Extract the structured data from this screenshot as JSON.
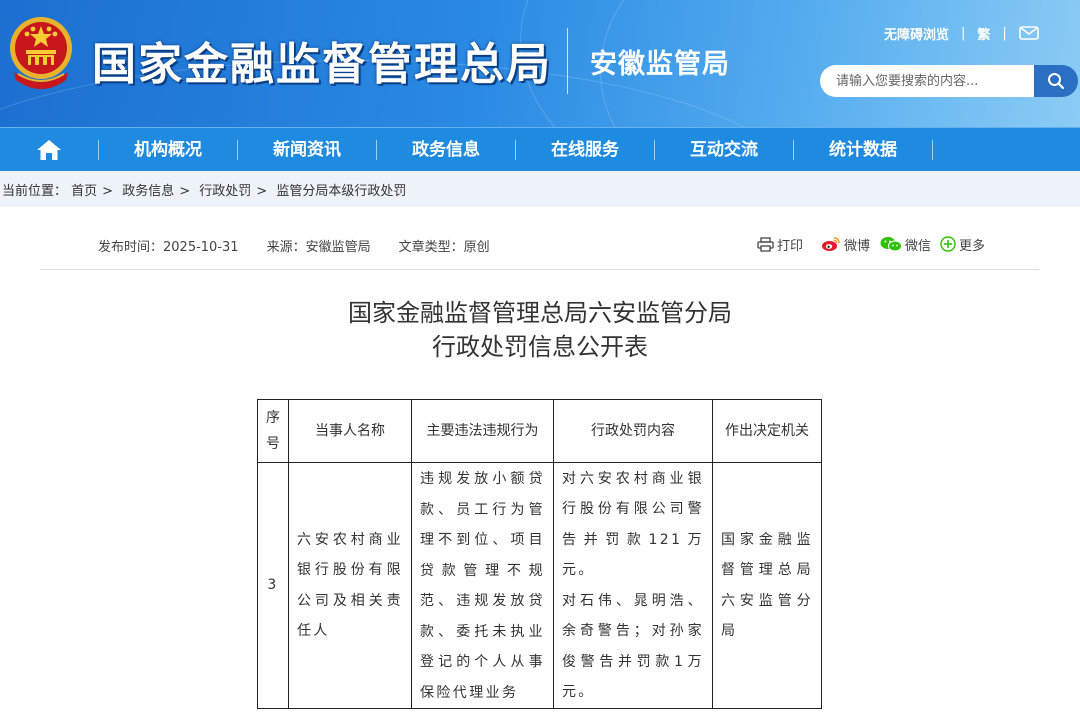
{
  "header": {
    "main_title": "国家金融监督管理总局",
    "sub_title": "安徽监管局",
    "links": {
      "accessibility": "无障碍浏览",
      "traditional": "繁"
    },
    "search": {
      "placeholder": "请输入您要搜索的内容..."
    },
    "colors": {
      "banner_start": "#1c6fd0",
      "banner_end": "#8cccf5",
      "nav": "#1e8ae0"
    }
  },
  "nav": {
    "items": [
      "机构概况",
      "新闻资讯",
      "政务信息",
      "在线服务",
      "互动交流",
      "统计数据"
    ]
  },
  "breadcrumb": {
    "prefix": "当前位置：",
    "items": [
      "首页",
      "政务信息",
      "行政处罚",
      "监管分局本级行政处罚"
    ]
  },
  "article": {
    "publish_time": "发布时间：2025-10-31",
    "source": "来源：安徽监管局",
    "type": "文章类型：原创",
    "share": {
      "print": "打印",
      "weibo": "微博",
      "wechat": "微信",
      "more": "更多"
    },
    "title_line1": "国家金融监督管理总局六安监管分局",
    "title_line2": "行政处罚信息公开表"
  },
  "table": {
    "headers": [
      "序号",
      "当事人名称",
      "主要违法违规行为",
      "行政处罚内容",
      "作出决定机关"
    ],
    "rows": [
      {
        "index": "3",
        "party": "六安农村商业银行股份有限公司及相关责任人",
        "violation": "违规发放小额贷款、员工行为管理不到位、项目贷款管理不规范、违规发放贷款、委托未执业登记的个人从事保险代理业务",
        "penalty_line1": "对六安农村商业银行股份有限公司警告并罚款121万元。",
        "penalty_line2": "对石伟、晁明浩、余奇警告；对孙家俊警告并罚款1万元。",
        "authority": "国家金融监督管理总局六安监管分局"
      }
    ]
  }
}
